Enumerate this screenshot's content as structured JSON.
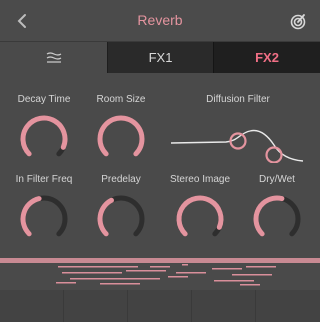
{
  "header": {
    "title": "Reverb",
    "back_icon": "chevron-left-icon",
    "preset_icon": "gauge-icon"
  },
  "tabs": [
    {
      "label": "",
      "icon": "waves-icon"
    },
    {
      "label": "FX1"
    },
    {
      "label": "FX2",
      "active": true
    }
  ],
  "colors": {
    "accent": "#e4949f",
    "tab_active_text": "#f06f85",
    "knob_track": "#2e2e2e",
    "knob_fill": "#e4949f"
  },
  "knobs_row1": [
    {
      "label": "Decay Time",
      "value": 0.92
    },
    {
      "label": "Room Size",
      "value": 1.0
    }
  ],
  "diffusion": {
    "label": "Diffusion Filter"
  },
  "knobs_row2": [
    {
      "label": "In Filter Freq",
      "value": 0.45
    },
    {
      "label": "Predelay",
      "value": 0.4
    },
    {
      "label": "Stereo Image",
      "value": 0.92
    },
    {
      "label": "Dry/Wet",
      "value": 0.55
    }
  ]
}
